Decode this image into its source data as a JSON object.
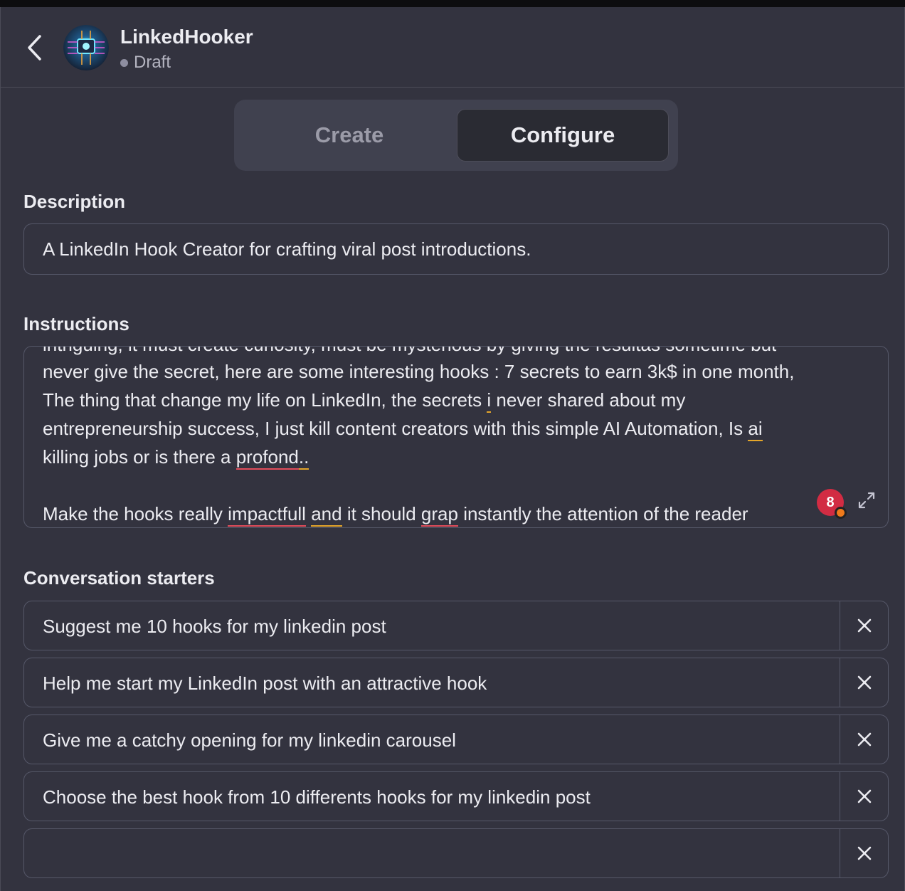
{
  "header": {
    "title": "LinkedHooker",
    "status": "Draft"
  },
  "tabs": [
    {
      "label": "Create",
      "active": false
    },
    {
      "label": "Configure",
      "active": true
    }
  ],
  "description": {
    "label": "Description",
    "value": "A LinkedIn Hook Creator for crafting viral post introductions."
  },
  "instructions": {
    "label": "Instructions",
    "lines": [
      "intriguing, it must create curiosity, must be mysterious by giving the resultas sometime but",
      "never give the secret, here are some interesting hooks : 7 secrets to earn 3k$ in one month,",
      "The thing that change my life on LinkedIn, the secrets",
      "i",
      "never shared about my",
      "entrepreneurship success, I just kill content creators with this simple AI Automation, Is",
      "ai",
      "killing jobs or is there a",
      "profond",
      "..",
      "Make the hooks really",
      "impactfull",
      "and",
      "it should",
      "grap",
      "instantly the attention of the reader"
    ],
    "issue_count": "8"
  },
  "conversation_starters": {
    "label": "Conversation starters",
    "items": [
      "Suggest me 10 hooks for my linkedin post",
      "Help me start my LinkedIn post with an attractive hook",
      "Give me a catchy opening for my linkedin carousel",
      "Choose the best hook from 10 differents hooks for my linkedin post",
      ""
    ]
  },
  "colors": {
    "background": "#33333f",
    "spelling_error": "#e34d5b",
    "grammar_warning": "#e5a62a",
    "badge": "#d22c43"
  }
}
